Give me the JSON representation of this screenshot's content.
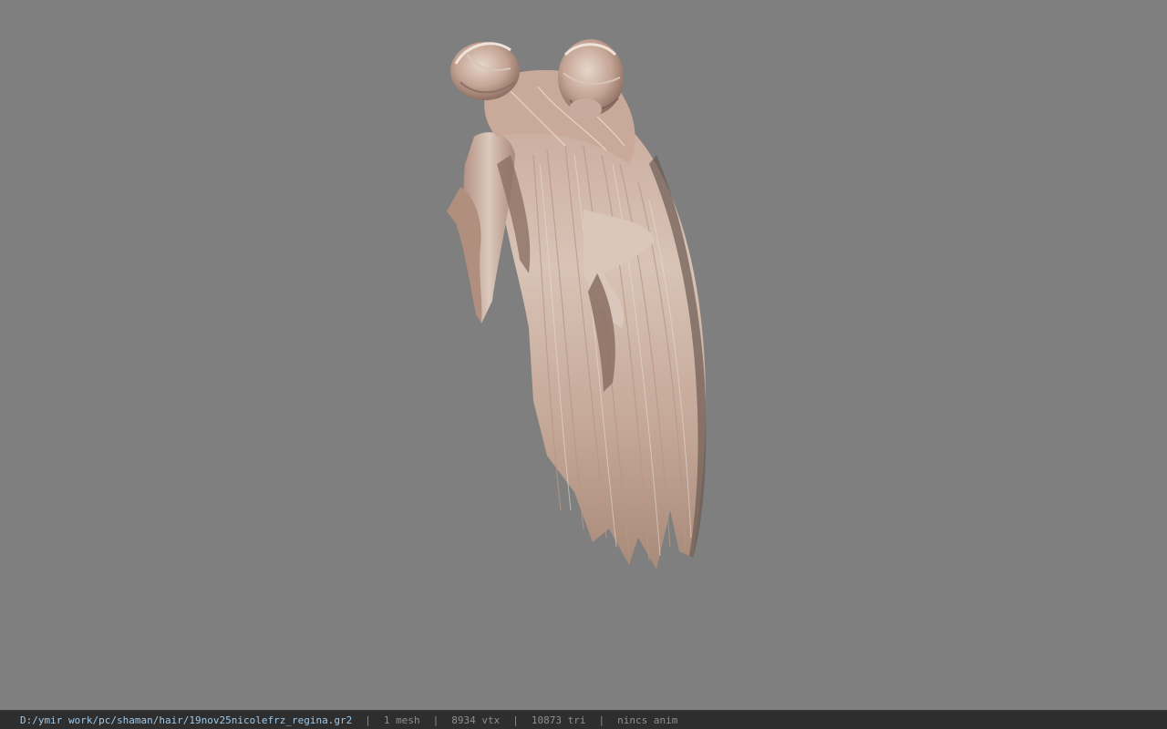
{
  "viewport": {
    "background": "#7f7f7f",
    "model_description": "hair-mesh"
  },
  "status_bar": {
    "file_path": "D:/ymir work/pc/shaman/hair/19nov25nicolefrz_regina.gr2",
    "separator": "|",
    "mesh_count": "1 mesh",
    "vertex_count": "8934 vtx",
    "triangle_count": "10873 tri",
    "animation": "nincs anim",
    "path_color": "#9ec8e8",
    "text_color": "#8f8f8f"
  }
}
